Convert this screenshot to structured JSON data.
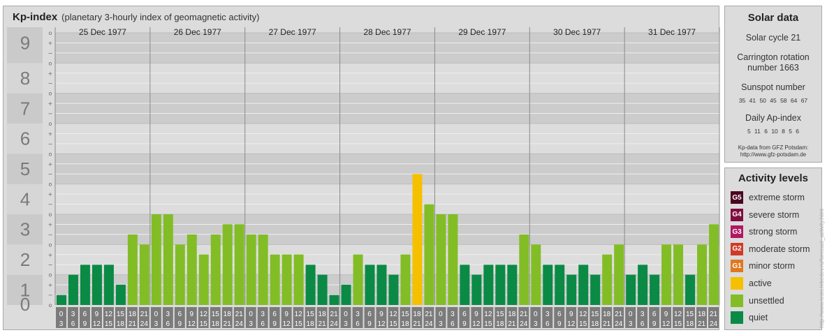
{
  "header": {
    "title": "Kp-index",
    "subtitle": "(planetary 3-hourly index of geomagnetic activity)"
  },
  "chart_data": {
    "type": "bar",
    "ylim": [
      0,
      9
    ],
    "y_ticks": [
      "0",
      "1",
      "2",
      "3",
      "4",
      "5",
      "6",
      "7",
      "8",
      "9"
    ],
    "sub_ticks": [
      "+",
      "o",
      "−"
    ],
    "days": [
      "25 Dec 1977",
      "26 Dec 1977",
      "27 Dec 1977",
      "28 Dec 1977",
      "29 Dec 1977",
      "30 Dec 1977",
      "31 Dec 1977"
    ],
    "interval_start": [
      "0",
      "3",
      "6",
      "9",
      "12",
      "15",
      "18",
      "21"
    ],
    "interval_end": [
      "3",
      "6",
      "9",
      "12",
      "15",
      "18",
      "21",
      "24"
    ],
    "values": [
      0.33,
      1.0,
      1.33,
      1.33,
      1.33,
      0.67,
      2.33,
      2.0,
      3.0,
      3.0,
      2.0,
      2.33,
      1.67,
      2.33,
      2.67,
      2.67,
      2.33,
      2.33,
      1.67,
      1.67,
      1.67,
      1.33,
      1.0,
      0.33,
      0.67,
      1.67,
      1.33,
      1.33,
      1.0,
      1.67,
      4.33,
      3.33,
      3.0,
      3.0,
      1.33,
      1.0,
      1.33,
      1.33,
      1.33,
      2.33,
      2.0,
      1.33,
      1.33,
      1.0,
      1.33,
      1.0,
      1.67,
      2.0,
      1.0,
      1.33,
      1.0,
      2.0,
      2.0,
      1.0,
      2.0,
      2.67
    ],
    "level_colors": {
      "quiet": "#0a8a45",
      "unsettled": "#82bd26",
      "active": "#f5c000",
      "minor": "#e07820",
      "moderate": "#d03a28",
      "strong": "#b01860",
      "severe": "#800c40",
      "extreme": "#4a0420"
    }
  },
  "solar": {
    "title": "Solar data",
    "cycle": "Solar cycle 21",
    "carrington_line1": "Carrington rotation",
    "carrington_line2": "number 1663",
    "sunspot_title": "Sunspot number",
    "sunspot_values": "35 41 50 45 58 64 67",
    "ap_title": "Daily Ap-index",
    "ap_values": "5 11 6 10 8 5 6",
    "credit_line1": "Kp-data from GFZ Potsdam:",
    "credit_line2": "http://www.gfz-potsdam.de"
  },
  "levels": {
    "title": "Activity levels",
    "items": [
      {
        "code": "G5",
        "label": "extreme storm",
        "color": "#4a0420"
      },
      {
        "code": "G4",
        "label": "severe storm",
        "color": "#800c40"
      },
      {
        "code": "G3",
        "label": "strong storm",
        "color": "#b01860"
      },
      {
        "code": "G2",
        "label": "moderate storm",
        "color": "#d03a28"
      },
      {
        "code": "G1",
        "label": "minor storm",
        "color": "#e07820"
      },
      {
        "code": "",
        "label": "active",
        "color": "#f5c000"
      },
      {
        "code": "",
        "label": "unsettled",
        "color": "#82bd26"
      },
      {
        "code": "",
        "label": "quiet",
        "color": "#0a8a45"
      }
    ]
  },
  "watermark": "http://www.tesis.lebedev.ru/forecast_activity.html"
}
